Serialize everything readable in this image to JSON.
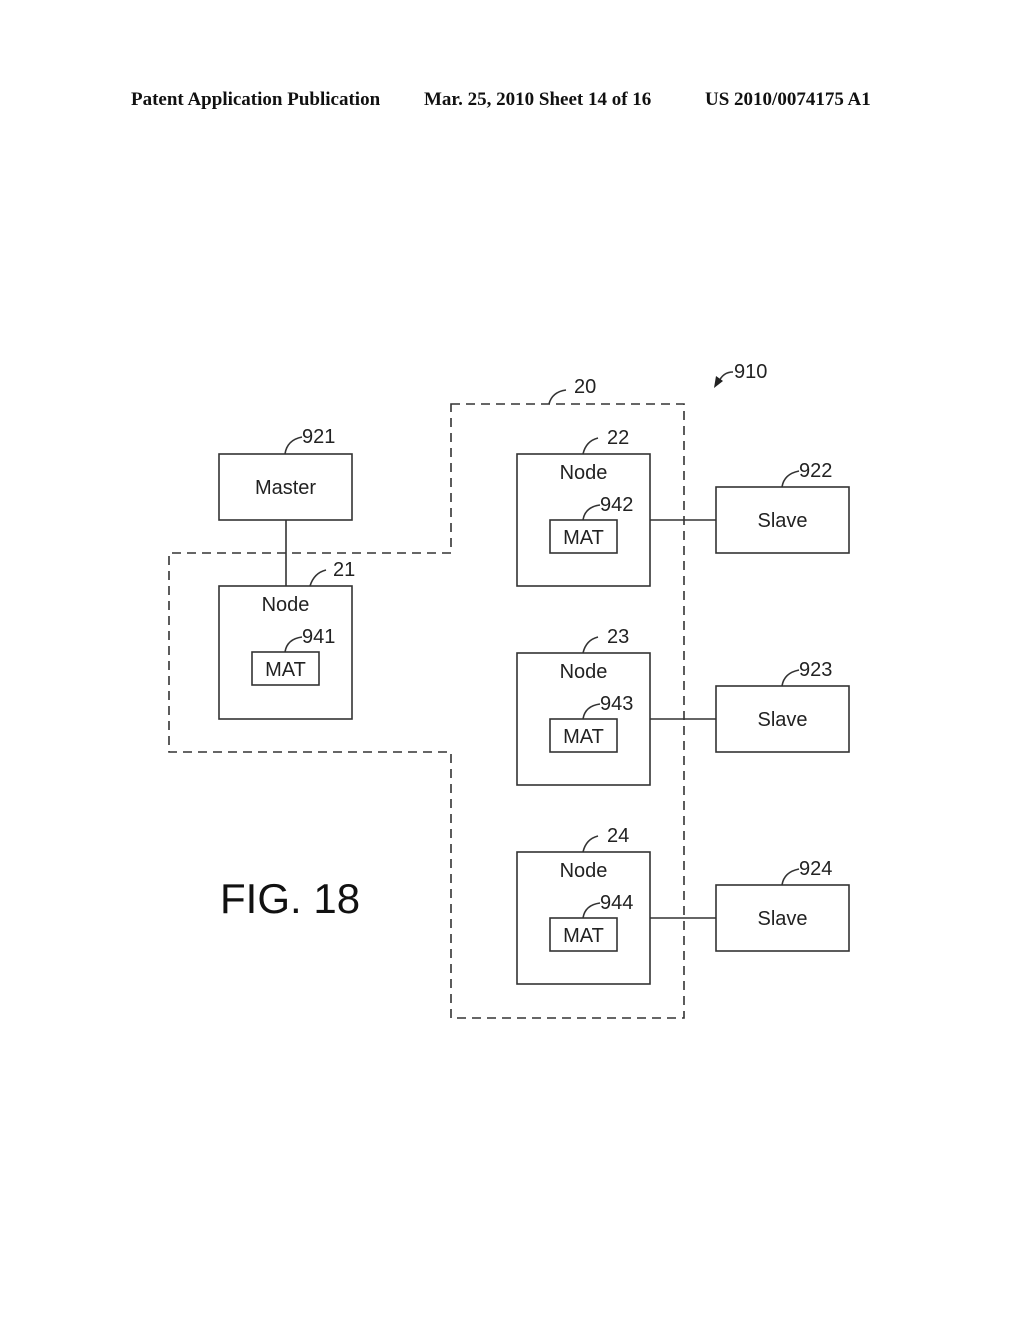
{
  "header": {
    "left": "Patent Application Publication",
    "middle": "Mar. 25, 2010  Sheet 14 of 16",
    "right": "US 2010/0074175 A1"
  },
  "figure": {
    "label": "FIG. 18",
    "system_ref": "910",
    "group_ref": "20",
    "subgroup_ref": "21",
    "master": {
      "ref": "921",
      "label": "Master"
    },
    "nodes": [
      {
        "ref": "21",
        "label": "Node",
        "mat_label": "MAT",
        "mat_ref": "941"
      },
      {
        "ref": "22",
        "label": "Node",
        "mat_label": "MAT",
        "mat_ref": "942"
      },
      {
        "ref": "23",
        "label": "Node",
        "mat_label": "MAT",
        "mat_ref": "943"
      },
      {
        "ref": "24",
        "label": "Node",
        "mat_label": "MAT",
        "mat_ref": "944"
      }
    ],
    "slaves": [
      {
        "ref": "922",
        "label": "Slave"
      },
      {
        "ref": "923",
        "label": "Slave"
      },
      {
        "ref": "924",
        "label": "Slave"
      }
    ]
  }
}
